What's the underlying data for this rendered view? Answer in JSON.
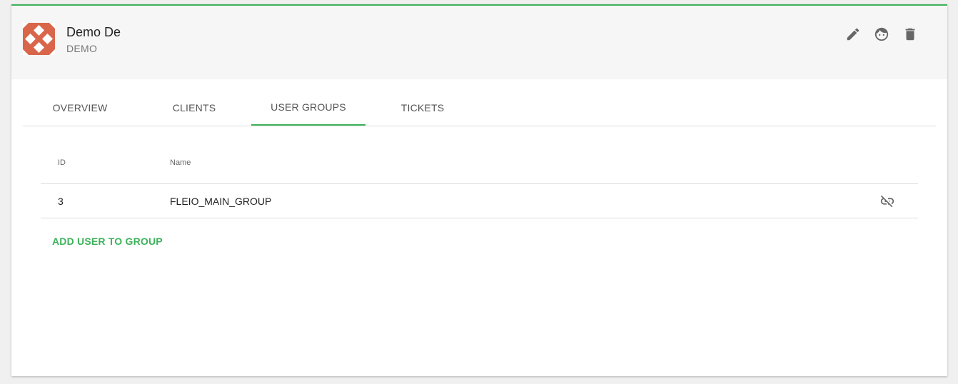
{
  "header": {
    "title": "Demo De",
    "subtitle": "DEMO",
    "actions": [
      {
        "icon": "pencil-icon",
        "label": "Edit"
      },
      {
        "icon": "face-icon",
        "label": "Impersonate"
      },
      {
        "icon": "trash-icon",
        "label": "Delete"
      }
    ]
  },
  "tabs": [
    {
      "label": "OVERVIEW",
      "active": false
    },
    {
      "label": "CLIENTS",
      "active": false
    },
    {
      "label": "USER GROUPS",
      "active": true
    },
    {
      "label": "TICKETS",
      "active": false
    }
  ],
  "table": {
    "columns": [
      "ID",
      "Name"
    ],
    "rows": [
      {
        "id": "3",
        "name": "FLEIO_MAIN_GROUP"
      }
    ]
  },
  "add_link": "ADD USER TO GROUP",
  "colors": {
    "accent": "#3db25b",
    "avatar": "#d9664a"
  }
}
